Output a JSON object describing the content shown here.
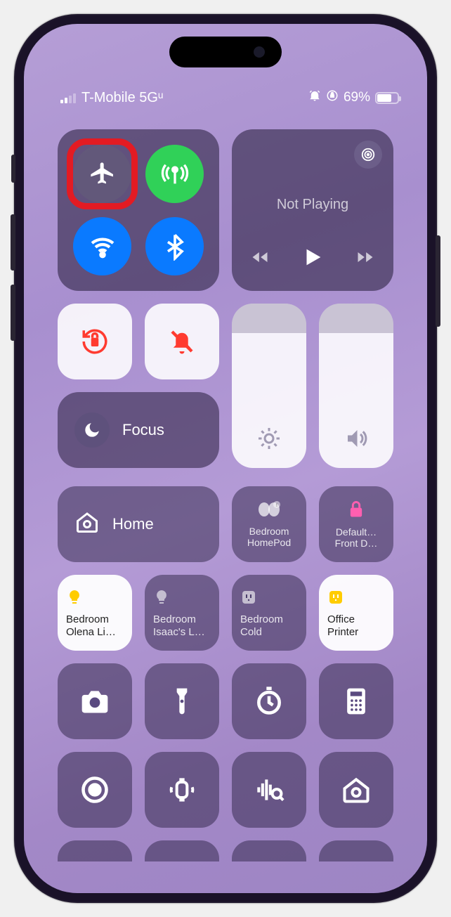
{
  "status": {
    "carrier": "T-Mobile 5Gᵘ",
    "battery_pct": "69%"
  },
  "connectivity": {
    "airplane": "airplane-icon",
    "cellular": "cellular-icon",
    "wifi": "wifi-icon",
    "bluetooth": "bluetooth-icon"
  },
  "media": {
    "status": "Not Playing"
  },
  "focus": {
    "label": "Focus"
  },
  "home": {
    "label": "Home",
    "tiles": [
      {
        "line1": "Bedroom",
        "line2": "HomePod"
      },
      {
        "line1": "Default…",
        "line2": "Front D…"
      }
    ],
    "accessories": [
      {
        "line1": "Bedroom",
        "line2": "Olena Li…"
      },
      {
        "line1": "Bedroom",
        "line2": "Isaac's L…"
      },
      {
        "line1": "Bedroom",
        "line2": "Cold"
      },
      {
        "line1": "Office",
        "line2": "Printer"
      }
    ]
  },
  "colors": {
    "green": "#30d158",
    "blue": "#0a7aff",
    "red_highlight": "#e31b23",
    "pink": "#ff5fb0",
    "yellow": "#ffcc00"
  }
}
